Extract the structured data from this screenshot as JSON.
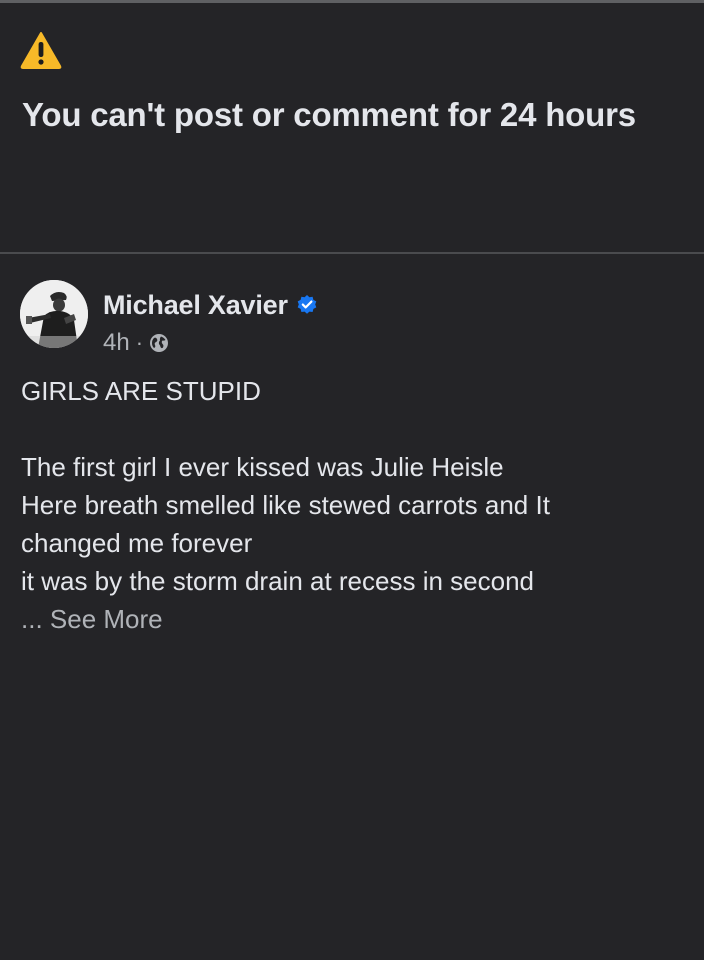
{
  "colors": {
    "background": "#242427",
    "text_primary": "#e4e6eb",
    "text_secondary": "#b0b3b8",
    "warning": "#f7b928",
    "verified": "#1877f2"
  },
  "restriction": {
    "icon": "warning-icon",
    "title": "You can't post or comment for 24 hours"
  },
  "post": {
    "author": {
      "name": "Michael Xavier",
      "verified_icon": "verified-badge-icon",
      "avatar_icon": "avatar"
    },
    "timestamp": "4h",
    "separator": "·",
    "privacy_icon": "globe-icon",
    "headline": "GIRLS ARE STUPID",
    "body_lines": [
      "The first girl I ever kissed was Julie Heisle",
      "Here breath smelled like stewed carrots and It",
      "changed me forever",
      "it was by the storm drain at recess in second"
    ],
    "ellipsis": "...",
    "see_more": "See More"
  }
}
